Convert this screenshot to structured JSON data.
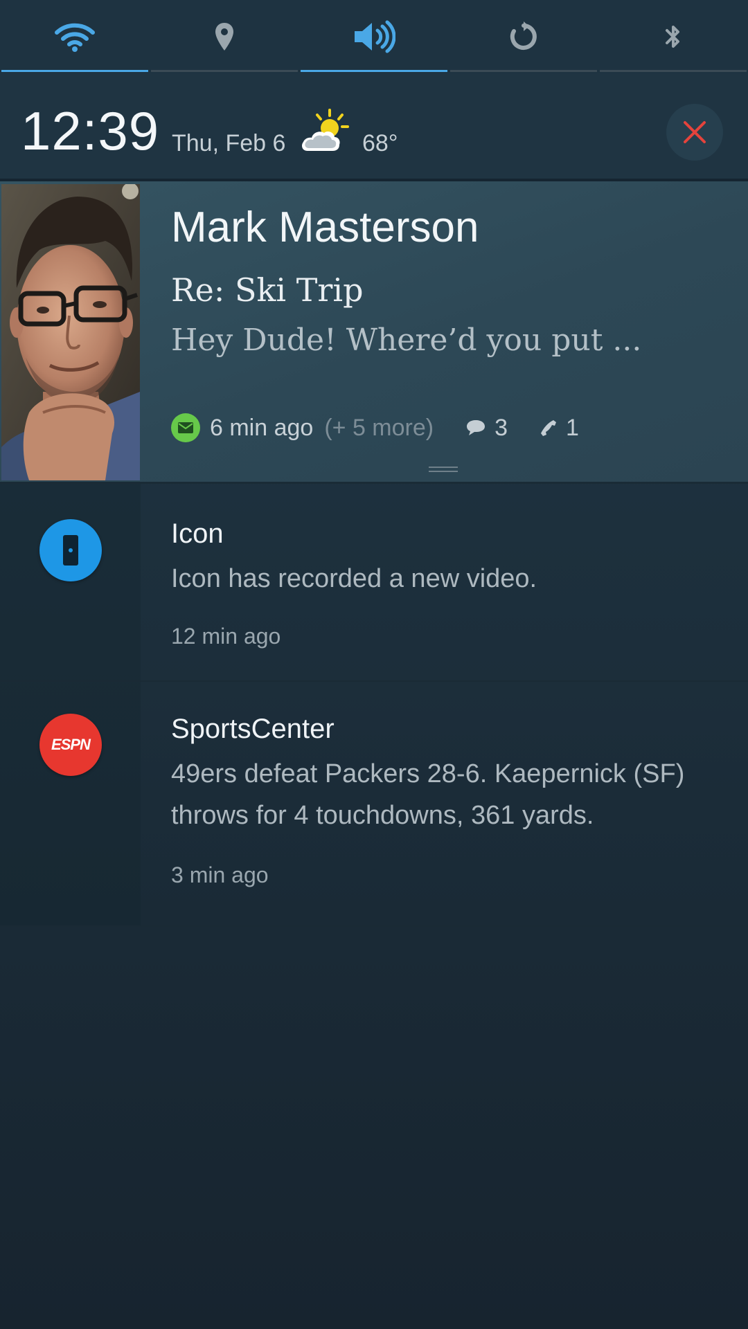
{
  "quick_toggles": [
    {
      "name": "wifi",
      "icon": "wifi-icon",
      "active": true
    },
    {
      "name": "location",
      "icon": "location-pin-icon",
      "active": false
    },
    {
      "name": "sound",
      "icon": "volume-icon",
      "active": true
    },
    {
      "name": "rotation",
      "icon": "rotate-icon",
      "active": false
    },
    {
      "name": "bluetooth",
      "icon": "bluetooth-icon",
      "active": false
    }
  ],
  "header": {
    "time": "12:39",
    "date": "Thu, Feb 6",
    "weather_icon": "partly-cloudy-icon",
    "temperature": "68°"
  },
  "expanded_notification": {
    "sender": "Mark Masterson",
    "subject": "Re: Ski Trip",
    "preview": "Hey Dude! Where’d  you put ...",
    "type_icon": "mail-icon",
    "time_ago": "6 min ago",
    "more": "(+ 5 more)",
    "messages_count": "3",
    "calls_count": "1"
  },
  "notifications": [
    {
      "app": "Icon",
      "icon": "icon-app-icon",
      "body": "Icon has recorded a new video.",
      "time": "12 min ago"
    },
    {
      "app": "SportsCenter",
      "icon": "espn-icon",
      "icon_text": "ESPN",
      "body": "49ers defeat Packers 28-6. Kaepernick (SF) throws for 4 touchdowns, 361 yards.",
      "time": "3 min ago"
    }
  ],
  "colors": {
    "accent": "#4aa8e6",
    "close": "#e5433c",
    "mail_badge": "#67c94a",
    "espn": "#e7372f",
    "icon_app": "#1e97e6"
  }
}
